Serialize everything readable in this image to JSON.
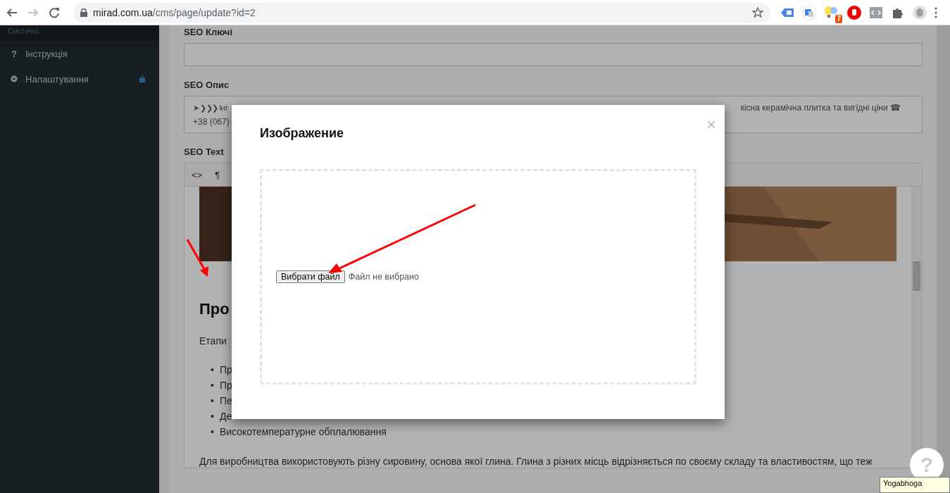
{
  "browser": {
    "url_host": "mirad.com.ua",
    "url_path": "/cms/page/update?id=2",
    "extension_badge": "7"
  },
  "sidebar": {
    "section": "Система",
    "items": [
      {
        "label": "Інструкція",
        "icon": "?",
        "locked": false
      },
      {
        "label": "Налаштування",
        "locked": true
      }
    ]
  },
  "seo_keys": {
    "label": "SEO Ключі"
  },
  "seo_description": {
    "label": "SEO Опис",
    "line_1_start": "➤ ❯❯❯ Інт",
    "line_1_end": "кісна керамічна плитка та вигідні ціни ☎",
    "line_2": "+38 (067)"
  },
  "seo_text": {
    "label": "SEO Text",
    "toolbar": [
      "<>",
      "¶"
    ],
    "heading": "Про",
    "intro": "Етапи",
    "list": [
      {
        "marker": "•",
        "text": "Пр"
      },
      {
        "marker": "•",
        "text": "Пр"
      },
      {
        "marker": "•",
        "text": "Пе"
      },
      {
        "marker": "•",
        "text": "Де"
      },
      {
        "marker": "•",
        "text": "Високотемпературне обплалювання"
      }
    ],
    "paragraph": "Для виробництва використовують різну сировину, основа якої глина. Глина з різних місць відрізняється по своєму складу та властивостям, що теж"
  },
  "modal": {
    "title": "Изображение",
    "close": "×",
    "file_button": "Вибрати файл",
    "file_status": "Файл не вибрано"
  },
  "help_button": "?",
  "tooltip": "Yogabhoga"
}
